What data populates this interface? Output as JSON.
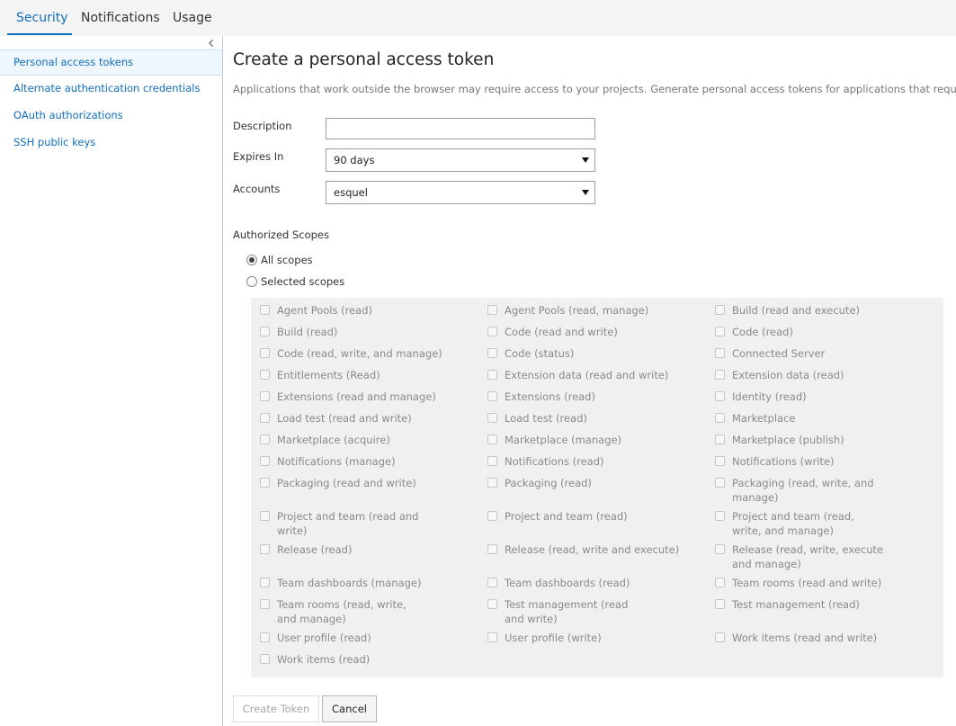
{
  "tabs": [
    {
      "label": "Security"
    },
    {
      "label": "Notifications"
    },
    {
      "label": "Usage"
    }
  ],
  "sidebar": {
    "items": [
      {
        "label": "Personal access tokens"
      },
      {
        "label": "Alternate authentication credentials"
      },
      {
        "label": "OAuth authorizations"
      },
      {
        "label": "SSH public keys"
      }
    ]
  },
  "main": {
    "title": "Create a personal access token",
    "subtitle": "Applications that work outside the browser may require access to your projects. Generate personal access tokens for applications that require a usernam"
  },
  "form": {
    "description_label": "Description",
    "description_value": "",
    "expires_label": "Expires In",
    "expires_value": "90 days",
    "accounts_label": "Accounts",
    "accounts_value": "esquel"
  },
  "scopes": {
    "section_label": "Authorized Scopes",
    "all_scopes_label": "All scopes",
    "selected_scopes_label": "Selected scopes",
    "selected": "All scopes",
    "items": [
      {
        "label": "Agent Pools (read)"
      },
      {
        "label": "Agent Pools (read, manage)"
      },
      {
        "label": "Build (read and execute)"
      },
      {
        "label": "Build (read)"
      },
      {
        "label": "Code (read and write)"
      },
      {
        "label": "Code (read)"
      },
      {
        "label": "Code (read, write, and manage)"
      },
      {
        "label": "Code (status)"
      },
      {
        "label": "Connected Server"
      },
      {
        "label": "Entitlements (Read)"
      },
      {
        "label": "Extension data (read and write)"
      },
      {
        "label": "Extension data (read)"
      },
      {
        "label": "Extensions (read and manage)"
      },
      {
        "label": "Extensions (read)"
      },
      {
        "label": "Identity (read)"
      },
      {
        "label": "Load test (read and write)"
      },
      {
        "label": "Load test (read)"
      },
      {
        "label": "Marketplace"
      },
      {
        "label": "Marketplace (acquire)"
      },
      {
        "label": "Marketplace (manage)"
      },
      {
        "label": "Marketplace (publish)"
      },
      {
        "label": "Notifications (manage)"
      },
      {
        "label": "Notifications (read)"
      },
      {
        "label": "Notifications (write)"
      },
      {
        "label": "Packaging (read and write)"
      },
      {
        "label": "Packaging (read)"
      },
      {
        "label": "Packaging (read, write, and manage)"
      },
      {
        "label": "Project and team (read and write)"
      },
      {
        "label": "Project and team (read)"
      },
      {
        "label": "Project and team (read, write, and manage)"
      },
      {
        "label": "Release (read)"
      },
      {
        "label": "Release (read, write and execute)"
      },
      {
        "label": "Release (read, write, execute and manage)"
      },
      {
        "label": "Team dashboards (manage)"
      },
      {
        "label": "Team dashboards (read)"
      },
      {
        "label": "Team rooms (read and write)"
      },
      {
        "label": "Team rooms (read, write, and manage)"
      },
      {
        "label": "Test management (read and write)"
      },
      {
        "label": "Test management (read)"
      },
      {
        "label": "User profile (read)"
      },
      {
        "label": "User profile (write)"
      },
      {
        "label": "Work items (read and write)"
      },
      {
        "label": "Work items (read)"
      }
    ]
  },
  "buttons": {
    "create_label": "Create Token",
    "cancel_label": "Cancel"
  },
  "colors": {
    "accent": "#106ebe",
    "panel_bg": "#f0f0f0"
  }
}
